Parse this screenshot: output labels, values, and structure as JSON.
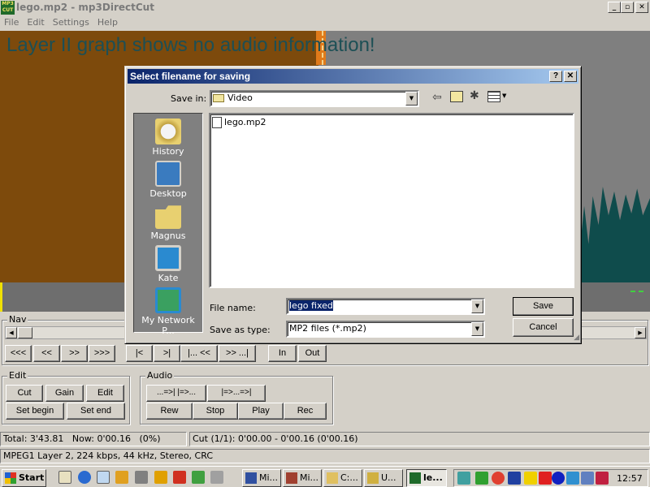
{
  "window": {
    "title": "lego.mp2 - mp3DirectCut"
  },
  "menu": [
    "File",
    "Edit",
    "Settings",
    "Help"
  ],
  "wave": {
    "message": "Layer II graph shows no audio information!"
  },
  "nav": {
    "label": "Nav",
    "buttons": [
      "<<<",
      "<<",
      ">>",
      ">>>",
      "|<",
      ">|",
      "|... <<",
      ">> ...|",
      "In",
      "Out"
    ]
  },
  "edit": {
    "label": "Edit",
    "cut": "Cut",
    "gain": "Gain",
    "edit": "Edit",
    "set_begin": "Set begin",
    "set_end": "Set end"
  },
  "audio": {
    "label": "Audio",
    "b1": "...=>|  |=>...",
    "b2": "|=>...=>|",
    "rew": "Rew",
    "stop": "Stop",
    "play": "Play",
    "rec": "Rec"
  },
  "status": {
    "total": "Total: 3'43.81",
    "now": "Now: 0'00.16",
    "pct": "(0%)",
    "cut": "Cut (1/1): 0'00.00 - 0'00.16 (0'00.16)",
    "info": "MPEG1 Layer 2, 224 kbps, 44 kHz, Stereo, CRC"
  },
  "dialog": {
    "title": "Select filename for saving",
    "save_in_label": "Save in:",
    "save_in_value": "Video",
    "places": [
      "History",
      "Desktop",
      "Magnus",
      "Kate",
      "My Network P..."
    ],
    "files": [
      "lego.mp2"
    ],
    "filename_label": "File name:",
    "filename_value": "lego fixed",
    "type_label": "Save as type:",
    "type_value": "MP2 files (*.mp2)",
    "save": "Save",
    "cancel": "Cancel"
  },
  "taskbar": {
    "start": "Start",
    "tasks": [
      "Mi...",
      "Mi...",
      "C:...",
      "U...",
      "le..."
    ],
    "clock": "12:57"
  }
}
